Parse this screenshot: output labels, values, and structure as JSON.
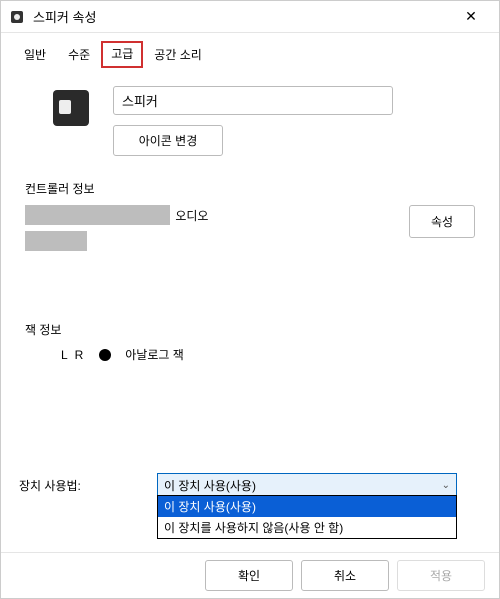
{
  "window": {
    "title": "스피커 속성"
  },
  "tabs": {
    "general": "일반",
    "levels": "수준",
    "advanced": "고급",
    "spatial": "공간 소리"
  },
  "device": {
    "name": "스피커",
    "icon_change": "아이콘 변경"
  },
  "controller": {
    "section_label": "컨트롤러 정보",
    "suffix": "오디오",
    "properties_btn": "속성"
  },
  "jack": {
    "section_label": "잭 정보",
    "lr": "L R",
    "type": "아날로그 잭"
  },
  "usage": {
    "label": "장치 사용법:",
    "selected": "이 장치 사용(사용)",
    "options": [
      "이 장치 사용(사용)",
      "이 장치를 사용하지 않음(사용 안 함)"
    ]
  },
  "footer": {
    "ok": "확인",
    "cancel": "취소",
    "apply": "적용"
  }
}
